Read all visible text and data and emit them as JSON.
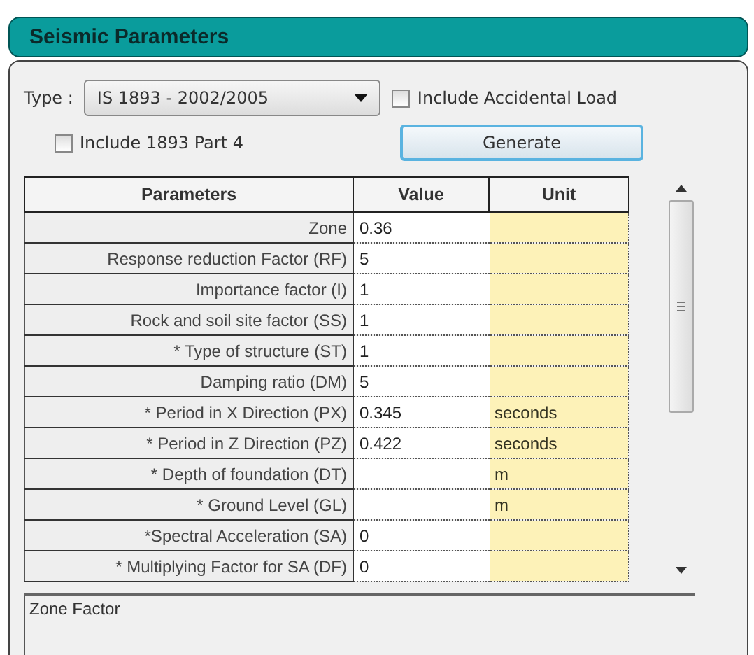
{
  "panel": {
    "title": "Seismic Parameters"
  },
  "type_field": {
    "label": "Type :",
    "value": "IS 1893 - 2002/2005"
  },
  "checkboxes": [
    {
      "label": "Include Accidental Load",
      "checked": false
    },
    {
      "label": "Include 1893 Part 4",
      "checked": false
    }
  ],
  "generate_button": {
    "label": "Generate"
  },
  "table": {
    "columns": [
      "Parameters",
      "Value",
      "Unit"
    ],
    "rows": [
      {
        "parameter": "Zone",
        "value": "0.36",
        "unit": ""
      },
      {
        "parameter": "Response reduction Factor (RF)",
        "value": "5",
        "unit": ""
      },
      {
        "parameter": "Importance factor (I)",
        "value": "1",
        "unit": ""
      },
      {
        "parameter": "Rock and soil site factor (SS)",
        "value": "1",
        "unit": ""
      },
      {
        "parameter": "* Type of structure (ST)",
        "value": "1",
        "unit": ""
      },
      {
        "parameter": "Damping ratio (DM)",
        "value": "5",
        "unit": ""
      },
      {
        "parameter": "* Period in X Direction (PX)",
        "value": "0.345",
        "unit": "seconds"
      },
      {
        "parameter": "* Period in Z Direction (PZ)",
        "value": "0.422",
        "unit": "seconds"
      },
      {
        "parameter": "* Depth of foundation (DT)",
        "value": "",
        "unit": "m"
      },
      {
        "parameter": "* Ground Level (GL)",
        "value": "",
        "unit": "m"
      },
      {
        "parameter": "*Spectral Acceleration (SA)",
        "value": "0",
        "unit": ""
      },
      {
        "parameter": "* Multiplying Factor for SA (DF)",
        "value": "0",
        "unit": ""
      }
    ]
  },
  "description": {
    "text": "Zone Factor"
  }
}
